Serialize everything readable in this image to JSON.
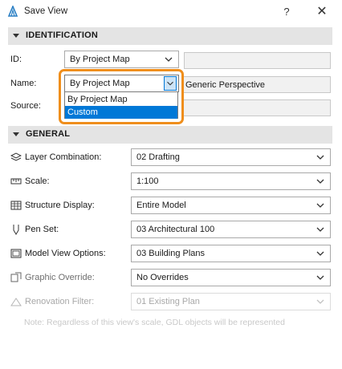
{
  "window": {
    "title": "Save View",
    "help": "?",
    "close": "✕"
  },
  "identification": {
    "header": "IDENTIFICATION",
    "id_label": "ID:",
    "id_select": "By Project Map",
    "id_text": "",
    "name_label": "Name:",
    "name_select": "By Project Map",
    "name_text": "Generic Perspective",
    "name_options": [
      "By Project Map",
      "Custom"
    ],
    "name_highlighted_option": "Custom",
    "source_label": "Source:",
    "source_text": ""
  },
  "general": {
    "header": "GENERAL",
    "rows": [
      {
        "label": "Layer Combination:",
        "value": "02 Drafting",
        "icon": "layers-icon"
      },
      {
        "label": "Scale:",
        "value": "1:100",
        "icon": "ruler-icon"
      },
      {
        "label": "Structure Display:",
        "value": "Entire Model",
        "icon": "structure-icon"
      },
      {
        "label": "Pen Set:",
        "value": "03 Architectural 100",
        "icon": "pen-icon"
      },
      {
        "label": "Model View Options:",
        "value": "03 Building Plans",
        "icon": "model-view-icon"
      },
      {
        "label": "Graphic Override:",
        "value": "No Overrides",
        "icon": "graphic-override-icon"
      },
      {
        "label": "Renovation Filter:",
        "value": "01 Existing Plan",
        "icon": "renovation-icon"
      }
    ],
    "note": "Note: Regardless of this view's scale, GDL objects will be represented"
  },
  "colors": {
    "highlight": "#ef8e1c",
    "selection": "#0078d7",
    "section_bg": "#e4e4e4"
  }
}
